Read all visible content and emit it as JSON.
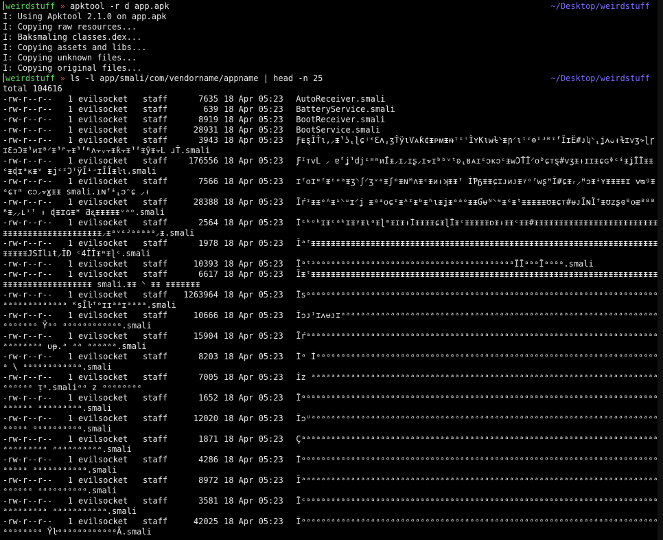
{
  "theme": {
    "background": "#000000",
    "text": "#e8e8e8",
    "user_color": "#59d159",
    "separator_color": "#e05a5a",
    "cwd_color": "#7a6cff"
  },
  "prompt1": {
    "user": "weirdstuff",
    "separator": "»",
    "command": "apktool -r d app.apk",
    "cwd": "~/Desktop/weirdstuff"
  },
  "apktool_output": [
    "I: Using Apktool 2.1.0 on app.apk",
    "I: Copying raw resources...",
    "I: Baksmaling classes.dex...",
    "I: Copying assets and libs...",
    "I: Copying unknown files...",
    "I: Copying original files..."
  ],
  "prompt2": {
    "user": "weirdstuff",
    "separator": "»",
    "command": "ls -l app/smali/com/vendorname/appname | head -n 25",
    "cwd": "~/Desktop/weirdstuff"
  },
  "total_line": "total 104616",
  "files": [
    {
      "perm": "-rw-r--r--",
      "links": "1",
      "owner": "evilsocket",
      "group": "staff",
      "size": "7635",
      "date": "18 Apr 05:23",
      "name": "AutoReceiver.smali"
    },
    {
      "perm": "-rw-r--r--",
      "links": "1",
      "owner": "evilsocket",
      "group": "staff",
      "size": "639",
      "date": "18 Apr 05:23",
      "name": "BatteryService.smali"
    },
    {
      "perm": "-rw-r--r--",
      "links": "1",
      "owner": "evilsocket",
      "group": "staff",
      "size": "8919",
      "date": "18 Apr 05:23",
      "name": "BootReceiver.smali"
    },
    {
      "perm": "-rw-r--r--",
      "links": "1",
      "owner": "evilsocket",
      "group": "staff",
      "size": "28931",
      "date": "18 Apr 05:23",
      "name": "BootService.smali"
    },
    {
      "perm": "-rw-r--r--",
      "links": "1",
      "owner": "evilsocket",
      "group": "staff",
      "size": "3943",
      "date": "18 Apr 05:23",
      "name": "ƑᴇȿÎŤι‚⸝ᵻ⸣ʖ⸤ɭɕʲᵋƐʌ⸥ʒŤÿιVᴀƙ¢ᵻᴘᴍᵻᵰᵎᶦꜝÎʏKιᴡɫ⸌ᵻɲ⸍ιᵎᶜʘᴵᴶᴿᶦ⸢ÎɪË#ᴊʮ⸌⸤ʝᴧᴗᵼɫɪⱱʒ⸟ɭɼɪƐᴐƆᵻ⸣ᴎɪᴮ⸍ᵻ⸣ᴾ⸟ᵻ⸣⸢ᴿʌ⸟ᵥ⸟ᵻƙ⸟ᵻ⸣⸢ᵻÿᵻ⸟L ɹŤ.smali"
    },
    {
      "perm": "-rw-r--r--",
      "links": "1",
      "owner": "evilsocket",
      "group": "staff",
      "size": "176556",
      "date": "18 Apr 05:23",
      "name": "ƑᴵᴛᴠL ⸝ ɐ⸢ʝ⸣djᵋᵐᵐᴎÎᵻ⸝ɪ⸝ɪʂ⸝ɪ⸟ɪᵇᵇᵛᵗʚ⸤ʙᴀɪᵋᴐᴋᴐᶜᵻᴡƆŤÎ⸍ᴏᴰɕᴛȿ#ᴠʒᵻᵼɪɪᵻɕɢᶲᶜᶤᵻʝÎÎᵻᵻᶜᵻɖɪᵃᴋᵻᵛ ᵻʝᶜᶦƆᵀÿÎᶤʴɪÎÎᵻŀι.smali"
    },
    {
      "perm": "-rw-r--r--",
      "links": "1",
      "owner": "evilsocket",
      "group": "staff",
      "size": "7566",
      "date": "18 Apr 05:23",
      "name": "ɪᶠᴏɪᶰᶠᵻᵋᵉᵃᵻʒ⸌ʃ⸍ʒᵛᵉᵻʃᵐᵻɴᴹʌᵻᶜᵻᴎᵼʞᵻᵻᶠ ÍƤᵷᵻᵻɕɪᴊᴎᴊᵻᵞᵒᶠᴡʂᴴÎ#ɕᵻᵣ⸝ᵸᴐᵻᶤʏᵻᵻᵻᵻɪ ᴠᴓᶢᵻᵃɕᴛᵐ ᴄᴐ⸝⸟ɣᵻᵻ smali.ıɴᶠᶤ⸤ᴐᵔɕ ⸝ᵼ"
    },
    {
      "perm": "-rw-r--r--",
      "links": "1",
      "owner": "evilsocket",
      "group": "staff",
      "size": "28388",
      "date": "18 Apr 05:23",
      "name": "Îŕᶦᵻᵻᵉᴬᵻᶤ⸌ᵘɪ⸍ʝ ᵻᶢᵃᴏɕᶦᵻᴬᶦᵻᵇᵻʰɩᵻʝᵻᵉᵃᵒᵻᵻƓᵾᴺ⸌ᶰᵻᶜᵻᵗᵻᵻᵻᵻᵻʊᵻɕᴛ#ᵾᴊÎɴÎᶠᵻʊᴢʂɞᴮᴏᴂᴮᴮᴮᴮᵻ⸝⸝ʟᶦᶠ ᵼ ɖᵻɪɢᵻᴴ Ƌᶓᵻᵻᵻᵻᵻᵛᵃᵒ.smali"
    },
    {
      "perm": "-rw-r--r--",
      "links": "1",
      "owner": "evilsocket",
      "group": "staff",
      "size": "2564",
      "date": "18 Apr 05:23",
      "name": "ÎᵋᵏᵒᵏɪᵻᶜᵃᵏɪᵻᵞᵻɩᵃᵻɭᵐᵻɪᵻᵼÍᵻᵻᵻᵻɕᵻɭÎᵻᶜᵻᵻᵻᵻᵻᴅᵻᵼᵻᵻᶜᵻᵻ#ᵻᵻᵻᵻᵻᵻᵻᵻᵻᵻᵻᵻᵻᵻᵻᵻᵻᵻᵻᵻᵻᵻᵻᵻᵻᵻᵻᵻᵻᵻᵻᵻᵻᵻᵻᵻᵻᵻᵻᵻᵻᵻᵻᵻᵻ⸝ᵻᵃᵛᵋᴶᵃᵃᵃᵃᵃ⸝ᵻ.smali"
    },
    {
      "perm": "-rw-r--r--",
      "links": "1",
      "owner": "evilsocket",
      "group": "staff",
      "size": "1978",
      "date": "18 Apr 05:23",
      "name": "ÎᵃᶠᵻᵻᵻᵻᵻᵻᵻᵻᵻᵻᵻᵻᵻᵻᵻᵻᵻᵻᵻᵻᵻᵻᵻᵻᵻᵻᵻᵻᵻᵻᵻᵻᵻᵻᵻᵻᵻᵻᵻᵻᵻᵻᵻᵻᵻᵻᵻᵻᵻᵻᵻᵻᵻᵻᵻᵻᵻᵻᵻᵻᵻᵻᵻᵻᵻᵻᵻᵻᵻᵻᵻᵻᵻᵻᵻJSÍlıŧ⸝ÎÐ ᶜ4ÎÎᵻᶰᵻɭᶜ.smali"
    },
    {
      "perm": "-rw-r--r--",
      "links": "1",
      "owner": "evilsocket",
      "group": "staff",
      "size": "10393",
      "date": "18 Apr 05:23",
      "name": "ÎᵃᵗᶟᵃᵃᵃᵃᵃᵃᵃᵃᵃᵃᵃᵃᵃᵃᵃᵃᵃᵃᵃᵃᵃᵃᵃᵃᵃᵃᵃᵃᵃᵃᵃᵃᵃᵃᵃᵃᵃᵃᵃᵃÎÎᵃᵃᵃÎᵃᵃᵃᵃ.smali"
    },
    {
      "perm": "-rw-r--r--",
      "links": "1",
      "owner": "evilsocket",
      "group": "staff",
      "size": "6617",
      "date": "18 Apr 05:23",
      "name": "Îᵻᵗᵻᵻᵻᵻᵻᵻᵻᵻᵻᵻᵻᵻᵻᵻᵻᵻᵻᵻᵻᵻᵻᵻᵻᵻᵻᵻᵻᵻᵻᵻᵻᵻᵻᵻᵻᵻᵻᵻᵻᵻᵻᵻᵻᵻᵻᵻᵻᵻᵻᵻᵻᵻᵻᵻᵻᵻᵻᵻᵻᵻᵻᵻᵻᵻᵻᵻᵻᵻᵻᵻᵻᵻᵻᵻᵻᵻᵻᵻᵻᵻᵻᵻᵻᵻᵻᵻᵻᵻ smali.ᵻᵻ ⸌ ᵻᵻ ᵻᵻᵻᵻᵻᵻᵻ"
    },
    {
      "perm": "-rw-r--r--",
      "links": "1",
      "owner": "evilsocket",
      "group": "staff",
      "size": "1263964",
      "date": "18 Apr 05:23",
      "name": "Îsᵃᵃᵃᵃᵃᵃᵃᵃᵃᵃᵃᵃᵃᵃᵃᵃᵃᵃᵃᵃᵃᵃᵃᵃᵃᵃᵃᵃᵃᵃᵃᵃᵃᵃᵃᵃᵃᵃᵃᵃᵃᵃᵃᵃᵃᵃᵃᵃᵃᵃᵃᵃᵃᵃᵃᵃᵃᵃᵃᵃᵃᵃᵃᵃᵃᵃᵃᵃᵃᵃᵃᵃᵃᵃᵃᵃᵃᵃᵃᵃᵃᵃᵃᵃ ᴷsÎŀᶠᵉɪɪᵃᵃɪᵃᵃᵃᵃ.smali"
    },
    {
      "perm": "-rw-r--r--",
      "links": "1",
      "owner": "evilsocket",
      "group": "staff",
      "size": "10666",
      "date": "18 Apr 05:23",
      "name": "Îᴐᴊᴵɪᴧᵾᴊɪᵃᵃᵃᵃᵃᵃᵃᵃᵃᵃᵃᵃᵃᵃᵃᵃᵃᵃᵃᵃᵃᵃᵃᵃᵃᵃᵃᵃᵃᵃᵃᵃᵃᵃᵃᵃᵃᵃᵃᵃᵃᵃᵃᵃᵃᵃᵃᵃᵃᵃᵃᵃᵃᵃᵃᵃᵃᵃᵃᵃᵃᵃᵃᵃᵃᵃᵃᵃᵃᵃᵃ Ÿᵃᵃ ᵃᵃᵃᵃᵃᵃᵃᵃᵃᵃᵃᵃ.smali"
    },
    {
      "perm": "-rw-r--r--",
      "links": "1",
      "owner": "evilsocket",
      "group": "staff",
      "size": "15904",
      "date": "18 Apr 05:23",
      "name": "Îŕᵃᵃᵃᵃᵃᵃᵃᵃᵃᵃᵃᵃᵃᵃᵃᵃᵃᵃᵃᵃᵃᵃᵃᵃᵃᵃᵃᵃᵃᵃᵃᵃᵃᵃᵃᵃᵃᵃᵃᵃᵃᵃᵃᵃᵃᵃᵃᵃᵃᵃᵃᵃᵃᵃᵃᵃᵃᵃᵃᵃᵃᵃᵃᵃᵃᵃᵃᵃᵃᵃᵃᵃᵃᵃᵃᵃᵃᵃᵃ ᴜᵽ.ᵃ ᵃᵃ ᵃᵃᵃᵃᵃᵃ.smali"
    },
    {
      "perm": "-rw-r--r--",
      "links": "1",
      "owner": "evilsocket",
      "group": "staff",
      "size": "8203",
      "date": "18 Apr 05:23",
      "name": "Îᵃ Íᵃᵃᵃᵃᵃᵃᵃᵃᵃᵃᵃᵃᵃᵃᵃᵃᵃᵃᵃᵃᵃᵃᵃᵃᵃᵃᵃᵃᵃᵃᵃᵃᵃᵃᵃᵃᵃᵃᵃᵃᵃᵃᵃᵃᵃᵃᵃᵃᵃᵃᵃᵃᵃᵃᵃᵃᵃᵃᵃᵃᵃᵃᵃᵃᵃᵃᵃᵃᵃᵃ \\ ᵃᵃᵃᵃᵃᵃᵃᵃᵃᵃᵃᵃ.smali"
    },
    {
      "perm": "-rw-r--r--",
      "links": "1",
      "owner": "evilsocket",
      "group": "staff",
      "size": "7005",
      "date": "18 Apr 05:23",
      "name": "Íz ᵃᵃᵃᵃᵃᵃᵃᵃᵃᵃᵃᵃᵃᵃᵃᵃᵃᵃᵃᵃᵃᵃᵃᵃᵃᵃᵃᵃᵃᵃᵃᵃᵃᵃᵃᵃᵃᵃᵃᵃᵃᵃᵃᵃᵃᵃᵃᵃᵃᵃᵃᵃᵃᵃᵃᵃᵃᵃᵃᵃᵃᵃᵃᵃᵃᵃᵃᵃᵃᵃᵃᵃᵃᵃᵃᵃ ᴉᵃ.smaliᵃᵃ z ᵃᵃᵃᵃᵃᵃᵃᵃ"
    },
    {
      "perm": "-rw-r--r--",
      "links": "1",
      "owner": "evilsocket",
      "group": "staff",
      "size": "1652",
      "date": "18 Apr 05:23",
      "name": "Îᵃᵃᵃᵃᵃᵃᵃᵃᵃᵃᵃᵃᵃᵃᵃᵃᵃᵃᵃᵃᵃᵃᵃᵃᵃᵃᵃᵃᵃᵃᵃᵃᵃᵃᵃᵃᵃᵃᵃᵃᵃᵃᵃᵃᵃᵃᵃᵃᵃᵃᵃᵃᵃᵃᵃᵃᵃᵃᵃᵃᵃᵃᵃᵃᵃᵃᵃᵃᵃᵃᵃᵃᵃᵃᵃᵃᵃᵃ ᵃᵃᵃᵃᵃᵃᵃᵃᵃ.smali"
    },
    {
      "perm": "-rw-r--r--",
      "links": "1",
      "owner": "evilsocket",
      "group": "staff",
      "size": "12020",
      "date": "18 Apr 05:23",
      "name": "Îᴐᵁᵃᵃᵃᵃᵃᵃᵃᵃᵃᵃᵃᵃᵃᵃᵃᵃᵃᵃᵃᵃᵃᵃᵃᵃᵃᵃᵃᵃᵃᵃᵃᵃᵃᵃᵃᵃᵃᵃᵃᵃᵃᵃᵃᵃᵃᵃᵃᵃᵃᵃᵃᵃᵃᵃᵃᵃᵃᵃᵃᵃᵃᵃᵃᵃᵃᵃᵃᵃᵃᵃᵃᵃᵃᵃᵃ ᵃᵃᵃᵃᵃᵃᵃᵃᵃᵃ.smali"
    },
    {
      "perm": "-rw-r--r--",
      "links": "1",
      "owner": "evilsocket",
      "group": "staff",
      "size": "1871",
      "date": "18 Apr 05:23",
      "name": "Çᵃᵃᵃᵃᵃᵃᵃᵃᵃᵃᵃᵃᵃᵃᵃᵃᵃᵃᵃᵃᵃᵃᵃᵃᵃᵃᵃᵃᵃᵃᵃᵃᵃᵃᵃᵃᵃᵃᵃᵃᵃᵃᵃᵃᵃᵃᵃᵃᵃᵃᵃᵃᵃᵃᵃᵃᵃᵃᵃᵃᵃᵃᵃᵃᵃᵃᵃᵃᵃᵃᵃᵃᵃᵃᵃᵃᵃᵃᵃᵃᵃ ᵃᵃᵃᵃᵃᵃᵃᵃᵃᵃ.smali"
    },
    {
      "perm": "-rw-r--r--",
      "links": "1",
      "owner": "evilsocket",
      "group": "staff",
      "size": "4286",
      "date": "18 Apr 05:23",
      "name": "Îᵃᵃᵃᵃᵃᵃᵃᵃᵃᵃᵃᵃᵃᵃᵃᵃᵃᵃᵃᵃᵃᵃᵃᵃᵃᵃᵃᵃᵃᵃᵃᵃᵃᵃᵃᵃᵃᵃᵃᵃᵃᵃᵃᵃᵃᵃᵃᵃᵃᵃᵃᵃᵃᵃᵃᵃᵃᵃᵃᵃᵃᵃᵃᵃᵃᵃᵃᵃᵃᵃᵃᵃᵃᵃᵃᵃᵃ ᵃᵃᵃᵃᵃᵃᵃᵃᵃᵃᵃ.smali"
    },
    {
      "perm": "-rw-r--r--",
      "links": "1",
      "owner": "evilsocket",
      "group": "staff",
      "size": "8972",
      "date": "18 Apr 05:23",
      "name": "Îᵃᵃᵃᵃᵃᵃᵃᵃᵃᵃᵃᵃᵃᵃᵃᵃᵃᵃᵃᵃᵃᵃᵃᵃᵃᵃᵃᵃᵃᵃᵃᵃᵃᵃᵃᵃᵃᵃᵃᵃᵃᵃᵃᵃᵃᵃᵃᵃᵃᵃᵃᵃᵃᵃᵃᵃᵃᵃᵃᵃᵃᵃᵃᵃᵃᵃᵃᵃᵃᵃᵃᵃᵃᵃᵃᵃᵃᵃ ᵃᵃᵃᵃᵃᵃᵃᵃᵃᵃ.smali"
    },
    {
      "perm": "-rw-r--r--",
      "links": "1",
      "owner": "evilsocket",
      "group": "staff",
      "size": "3581",
      "date": "18 Apr 05:23",
      "name": "Îᶜᵃᵃᵃᵃᵃᵃᵃᵃᵃᵃᵃᵃᵃᵃᵃᵃᵃᵃᵃᵃᵃᵃᵃᵃᵃᵃᵃᵃᵃᵃᵃᵃᵃᵃᵃᵃᵃᵃᵃᵃᵃᵃᵃᵃᵃᵃᵃᵃᵃᵃᵃᵃᵃᵃᵃᵃᵃᵃᵃᵃᵃᵃᵃᵃᵃᵃᵃᵃᵃᵃᵃᵃᵃᵃᵃᵃᵃᵃᵃᵃ ᵃᵃᵃᵃᵃᵃᵃᵃᵃᵃᵃ.smali"
    },
    {
      "perm": "-rw-r--r--",
      "links": "1",
      "owner": "evilsocket",
      "group": "staff",
      "size": "42025",
      "date": "18 Apr 05:23",
      "name": "Îᵃᵃᵃᵃᵃᵃᵃᵃᵃᵃᵃᵃᵃᵃᵃᵃᵃᵃᵃᵃᵃᵃᵃᵃᵃᵃᵃᵃᵃᵃᵃᵃᵃᵃᵃᵃᵃᵃᵃᵃᵃᵃᵃᵃᵃᵃᵃᵃᵃᵃᵃᵃᵃᵃᵃᵃᵃᵃᵃᵃᵃᵃᵃᵃᵃᵃᵃᵃᵃᵃᵃᵃᵃᵃᵃᵃᵃᵃᵃᵃ ŸŀᵃᵃᵃᵃᵃᵃᵃᵃᵃᵃᵃᵃÄ.smali"
    }
  ]
}
